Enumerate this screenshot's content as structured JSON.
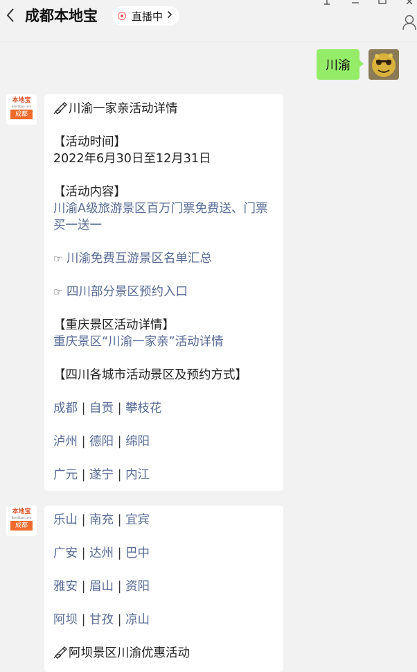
{
  "header": {
    "title": "成都本地宝",
    "live_label": "直播中"
  },
  "user_message": {
    "text": "川渝"
  },
  "bot": {
    "logo_text": "本地宝",
    "logo_sub": "Bendibao.com",
    "logo_city": "成都"
  },
  "message1": {
    "heading": "川渝一家亲活动详情",
    "time_label": "【活动时间】",
    "time_value": "2022年6月30日至12月31日",
    "content_label": "【活动内容】",
    "content_line1": "川渝A级旅游景区百万门票免费送、门票",
    "content_line2": "买一送一",
    "hand_icon": "☞",
    "link_free": "川渝免费互游景区名单汇总",
    "link_booking": "四川部分景区预约入口",
    "cq_label": "【重庆景区活动详情】",
    "cq_link": "重庆景区“川渝一家亲”活动详情",
    "sc_label": "【四川各城市活动景区及预约方式】",
    "separator": " | ",
    "cities": [
      [
        "成都",
        "自贡",
        "攀枝花"
      ],
      [
        "泸州",
        "德阳",
        "绵阳"
      ],
      [
        "广元",
        "遂宁",
        "内江"
      ]
    ]
  },
  "message2": {
    "cities": [
      [
        "乐山",
        "南充",
        "宜宾"
      ],
      [
        "广安",
        "达州",
        "巴中"
      ],
      [
        "雅安",
        "眉山",
        "资阳"
      ],
      [
        "阿坝",
        "甘孜",
        "凉山"
      ]
    ],
    "aba_heading": "阿坝景区川渝优惠活动"
  },
  "colors": {
    "link": "#576b95",
    "user_bubble": "#95ec69",
    "background": "#f2f2f2",
    "live_dot": "#fa5151"
  },
  "icons": {
    "back": "chevron-left-icon",
    "live": "live-dot-icon",
    "person": "person-icon",
    "hand": "pointing-hand-icon",
    "write": "writing-hand-icon"
  }
}
